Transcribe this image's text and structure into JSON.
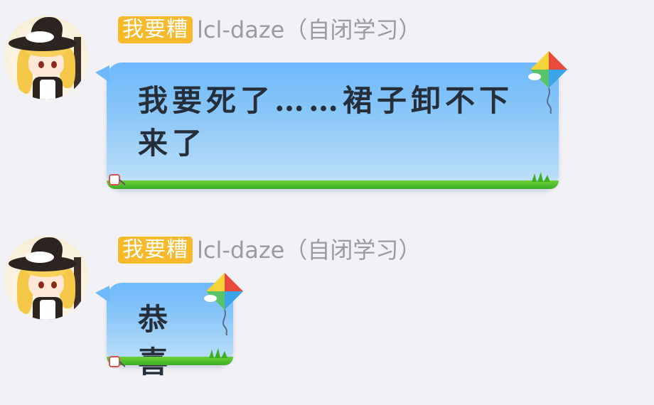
{
  "messages": [
    {
      "badge": "我要糟",
      "sender": "lcl-daze（自闭学习）",
      "text": "我要死了……裙子卸不下来了"
    },
    {
      "badge": "我要糟",
      "sender": "lcl-daze（自闭学习）",
      "text": "恭喜"
    }
  ],
  "icons": {
    "avatar": "avatar-marisa-chibi",
    "kite": "kite-icon",
    "spool": "kite-spool-icon",
    "grass": "grass-tuft-icon"
  },
  "colors": {
    "background": "#f1f1f6",
    "badge": "#f6b92b",
    "bubble_top": "#6eb9fb",
    "bubble_bottom": "#cfe7fa",
    "grass": "#3fae25",
    "text": "#262e3a",
    "username": "#9a9aa3"
  }
}
